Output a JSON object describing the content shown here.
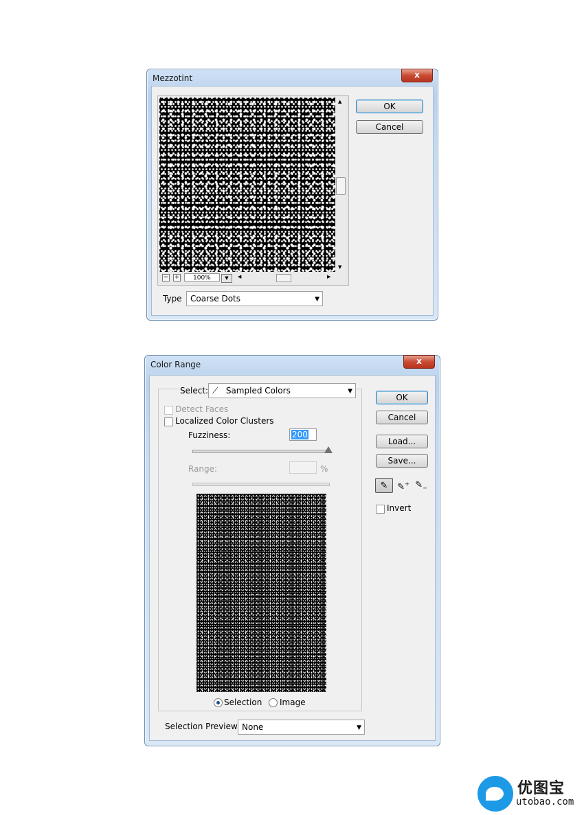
{
  "mezzotint": {
    "title": "Mezzotint",
    "close_label": "x",
    "ok_label": "OK",
    "cancel_label": "Cancel",
    "zoom_minus": "−",
    "zoom_plus": "+",
    "zoom_value": "100%",
    "type_label": "Type",
    "type_value": "Coarse Dots"
  },
  "color_range": {
    "title": "Color Range",
    "close_label": "x",
    "select_label": "Select:",
    "select_value": "Sampled Colors",
    "detect_faces_label": "Detect Faces",
    "localized_label": "Localized Color Clusters",
    "fuzziness_label": "Fuzziness:",
    "fuzziness_value": "200",
    "range_label": "Range:",
    "range_unit": "%",
    "ok_label": "OK",
    "cancel_label": "Cancel",
    "load_label": "Load...",
    "save_label": "Save...",
    "invert_label": "Invert",
    "selection_label": "Selection",
    "image_label": "Image",
    "preview_label": "Selection Preview:",
    "preview_value": "None"
  },
  "watermark": {
    "brand": "优图宝",
    "url": "utobao.com"
  }
}
